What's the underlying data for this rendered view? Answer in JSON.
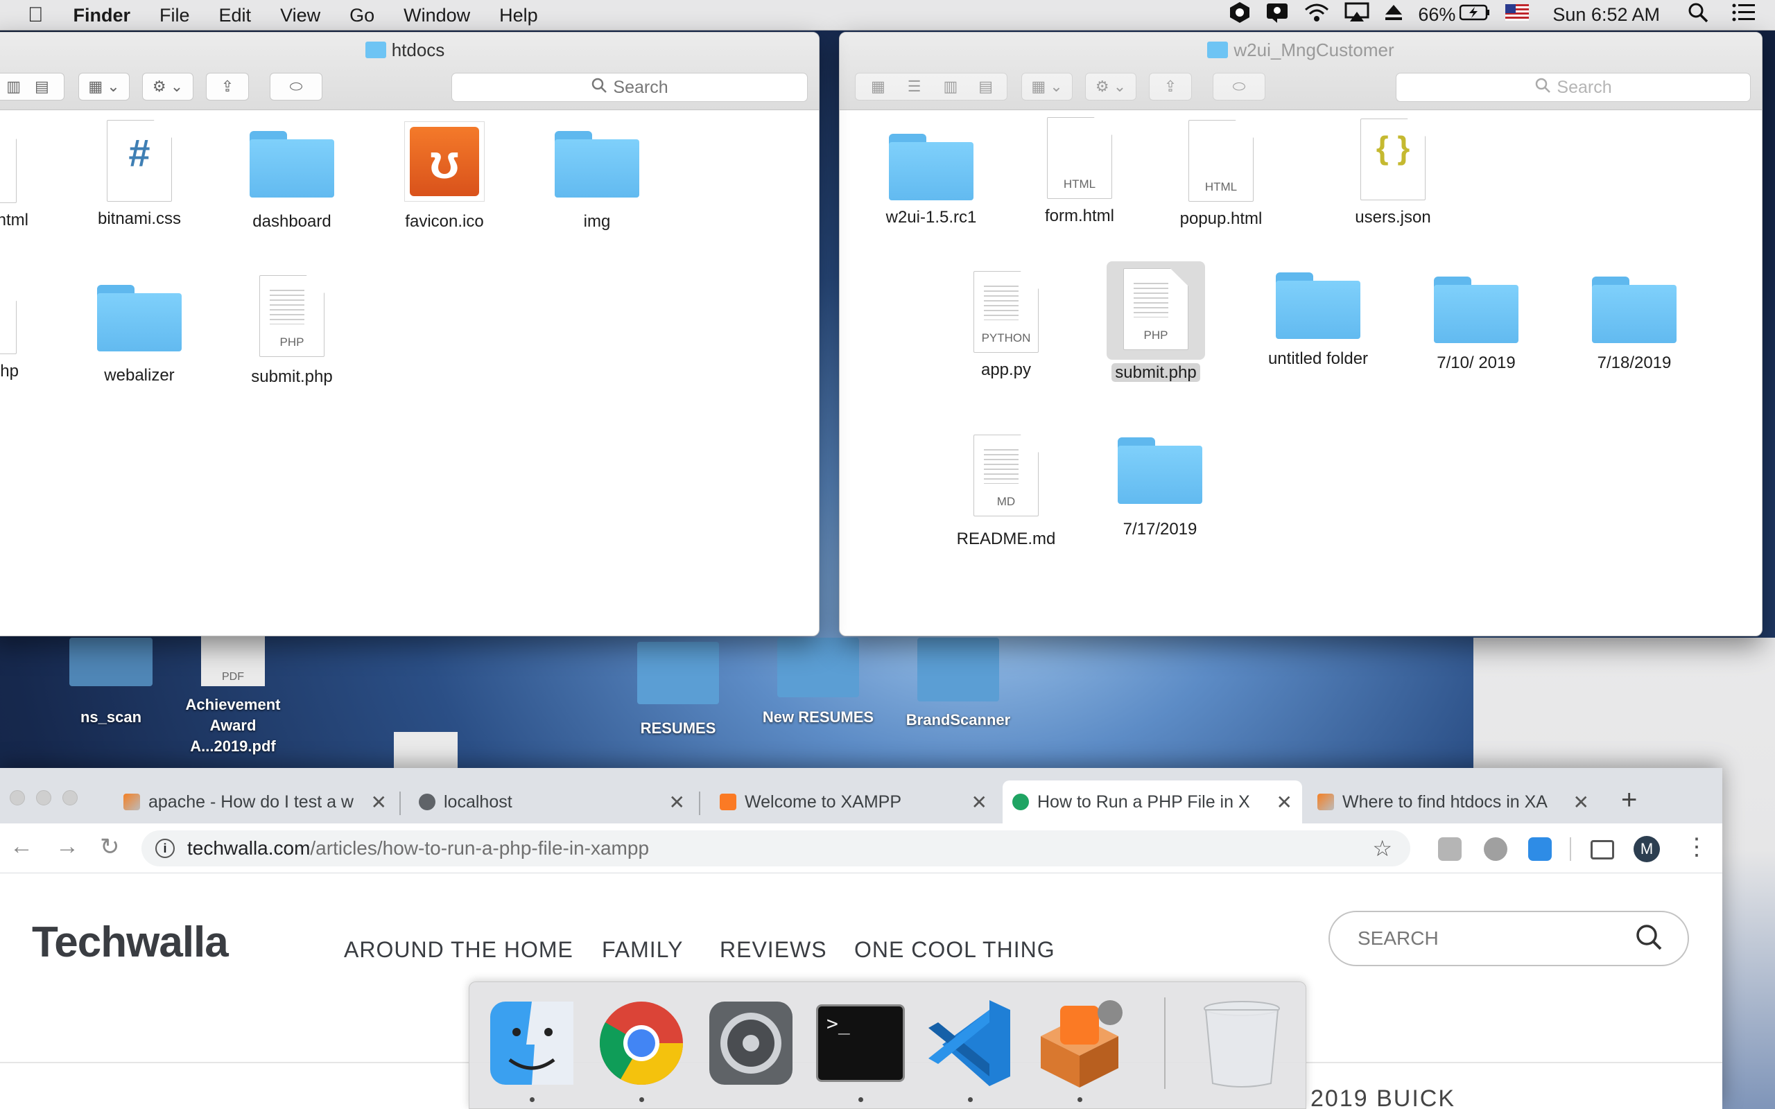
{
  "menubar": {
    "app": "Finder",
    "items": [
      "File",
      "Edit",
      "View",
      "Go",
      "Window",
      "Help"
    ],
    "battery": "66%",
    "clock": "Sun 6:52 AM"
  },
  "finder_left": {
    "title": "htdocs",
    "search_placeholder": "Search",
    "items": [
      "ns.html",
      "bitnami.css",
      "dashboard",
      "favicon.ico",
      "img",
      "php",
      "webalizer",
      "submit.php"
    ]
  },
  "finder_right": {
    "title": "w2ui_MngCustomer",
    "search_placeholder": "Search",
    "items": [
      "w2ui-1.5.rc1",
      "form.html",
      "popup.html",
      "users.json",
      "app.py",
      "submit.php",
      "untitled folder",
      "7/10/ 2019",
      "7/18/2019",
      "README.md",
      "7/17/2019"
    ],
    "file_exts": {
      "html": "HTML",
      "php": "PHP",
      "python": "PYTHON",
      "md": "MD"
    }
  },
  "desktop": {
    "icons": [
      "ns_scan",
      "Achievement Award A...2019.pdf",
      "RESUMES",
      "New RESUMES",
      "BrandScanner"
    ],
    "pdf_label": "PDF"
  },
  "browser": {
    "tabs": [
      {
        "title": "apache - How do I test a w",
        "icon": "stackoverflow-icon"
      },
      {
        "title": "localhost",
        "icon": "globe-icon"
      },
      {
        "title": "Welcome to XAMPP",
        "icon": "xampp-icon"
      },
      {
        "title": "How to Run a PHP File in X",
        "icon": "techwalla-icon",
        "active": true
      },
      {
        "title": "Where to find htdocs in XA",
        "icon": "stackoverflow-icon"
      }
    ],
    "url_host": "techwalla.com",
    "url_path": "/articles/how-to-run-a-php-file-in-xampp",
    "profile_initial": "M"
  },
  "page": {
    "logo": "Techwalla",
    "nav": [
      "AROUND THE HOME",
      "FAMILY",
      "REVIEWS",
      "ONE COOL THING"
    ],
    "search_placeholder": "SEARCH",
    "teaser": "2019 BUICK"
  },
  "dock": {
    "apps": [
      "Finder",
      "Google Chrome",
      "System Preferences",
      "Terminal",
      "Visual Studio Code",
      "XAMPP",
      "Trash"
    ],
    "terminal_prompt": ">_"
  }
}
